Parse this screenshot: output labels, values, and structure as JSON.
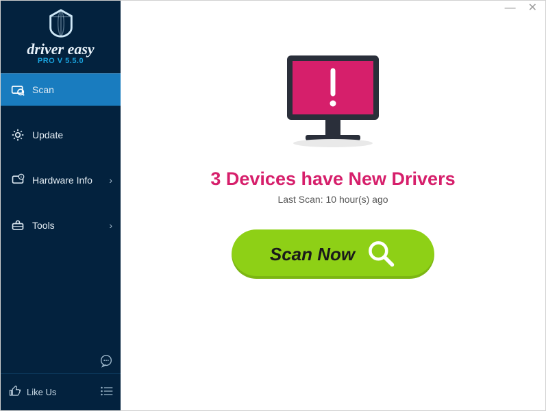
{
  "brand": {
    "name": "driver easy",
    "version": "PRO V 5.5.0"
  },
  "nav": {
    "scan": "Scan",
    "update": "Update",
    "hardware": "Hardware Info",
    "tools": "Tools"
  },
  "bottom": {
    "like": "Like Us"
  },
  "main": {
    "headline": "3 Devices have New Drivers",
    "last_scan": "Last Scan: 10 hour(s) ago",
    "scan_button": "Scan Now"
  },
  "colors": {
    "accent": "#197cbf",
    "alert": "#d61f6b",
    "action": "#8ed016",
    "sidebar": "#03223e"
  }
}
